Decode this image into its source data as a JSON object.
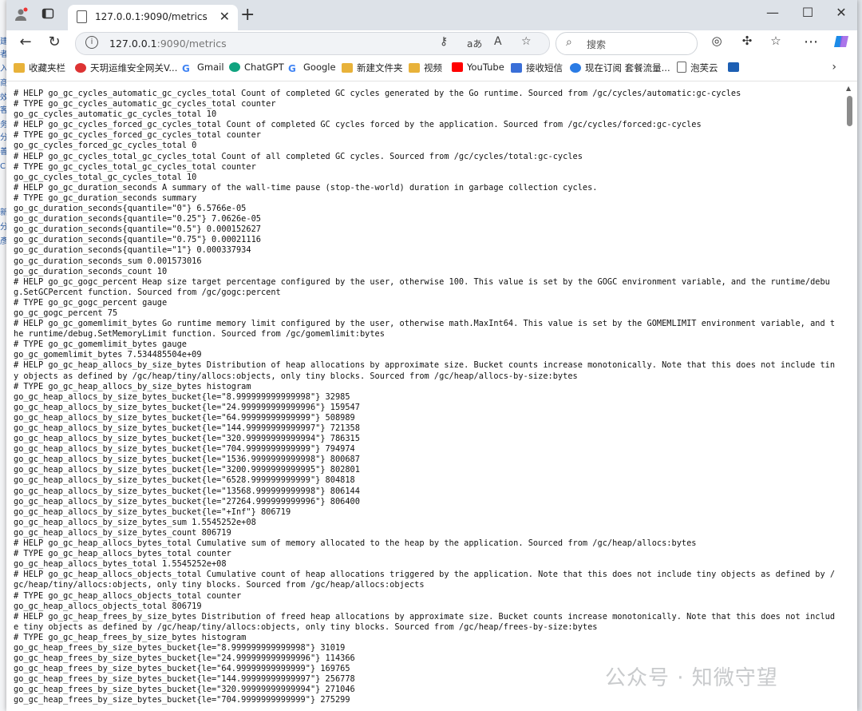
{
  "browser": {
    "tab_title": "127.0.0.1:9090/metrics",
    "url_host": "127.0.0.1",
    "url_rest": ":9090/metrics",
    "search_placeholder": "搜索",
    "aa_label": "aあ",
    "read_aloud_label": "A",
    "bookmarks": [
      {
        "label": "收藏夹栏",
        "color": "#e8b23a"
      },
      {
        "label": "天玥运维安全网关V...",
        "color": "#d33"
      },
      {
        "label": "Gmail",
        "color": "#4285f4"
      },
      {
        "label": "ChatGPT",
        "color": "#10a37f"
      },
      {
        "label": "Google",
        "color": "#4285f4"
      },
      {
        "label": "新建文件夹",
        "color": "#e8b23a"
      },
      {
        "label": "视频",
        "color": "#e8b23a"
      },
      {
        "label": "YouTube",
        "color": "#ff0000"
      },
      {
        "label": "接收短信",
        "color": "#3a6fd8"
      },
      {
        "label": "现在订阅 套餐流量...",
        "color": "#2a7be4"
      },
      {
        "label": "泡芙云",
        "color": "#888"
      },
      {
        "label": "",
        "color": "#1d5fb3"
      }
    ]
  },
  "metrics_text": "# HELP go_gc_cycles_automatic_gc_cycles_total Count of completed GC cycles generated by the Go runtime. Sourced from /gc/cycles/automatic:gc-cycles\n# TYPE go_gc_cycles_automatic_gc_cycles_total counter\ngo_gc_cycles_automatic_gc_cycles_total 10\n# HELP go_gc_cycles_forced_gc_cycles_total Count of completed GC cycles forced by the application. Sourced from /gc/cycles/forced:gc-cycles\n# TYPE go_gc_cycles_forced_gc_cycles_total counter\ngo_gc_cycles_forced_gc_cycles_total 0\n# HELP go_gc_cycles_total_gc_cycles_total Count of all completed GC cycles. Sourced from /gc/cycles/total:gc-cycles\n# TYPE go_gc_cycles_total_gc_cycles_total counter\ngo_gc_cycles_total_gc_cycles_total 10\n# HELP go_gc_duration_seconds A summary of the wall-time pause (stop-the-world) duration in garbage collection cycles.\n# TYPE go_gc_duration_seconds summary\ngo_gc_duration_seconds{quantile=\"0\"} 6.5766e-05\ngo_gc_duration_seconds{quantile=\"0.25\"} 7.0626e-05\ngo_gc_duration_seconds{quantile=\"0.5\"} 0.000152627\ngo_gc_duration_seconds{quantile=\"0.75\"} 0.00021116\ngo_gc_duration_seconds{quantile=\"1\"} 0.000337934\ngo_gc_duration_seconds_sum 0.001573016\ngo_gc_duration_seconds_count 10\n# HELP go_gc_gogc_percent Heap size target percentage configured by the user, otherwise 100. This value is set by the GOGC environment variable, and the runtime/debug.SetGCPercent function. Sourced from /gc/gogc:percent\n# TYPE go_gc_gogc_percent gauge\ngo_gc_gogc_percent 75\n# HELP go_gc_gomemlimit_bytes Go runtime memory limit configured by the user, otherwise math.MaxInt64. This value is set by the GOMEMLIMIT environment variable, and the runtime/debug.SetMemoryLimit function. Sourced from /gc/gomemlimit:bytes\n# TYPE go_gc_gomemlimit_bytes gauge\ngo_gc_gomemlimit_bytes 7.534485504e+09\n# HELP go_gc_heap_allocs_by_size_bytes Distribution of heap allocations by approximate size. Bucket counts increase monotonically. Note that this does not include tiny objects as defined by /gc/heap/tiny/allocs:objects, only tiny blocks. Sourced from /gc/heap/allocs-by-size:bytes\n# TYPE go_gc_heap_allocs_by_size_bytes histogram\ngo_gc_heap_allocs_by_size_bytes_bucket{le=\"8.999999999999998\"} 32985\ngo_gc_heap_allocs_by_size_bytes_bucket{le=\"24.999999999999996\"} 159547\ngo_gc_heap_allocs_by_size_bytes_bucket{le=\"64.99999999999999\"} 508989\ngo_gc_heap_allocs_by_size_bytes_bucket{le=\"144.99999999999997\"} 721358\ngo_gc_heap_allocs_by_size_bytes_bucket{le=\"320.99999999999994\"} 786315\ngo_gc_heap_allocs_by_size_bytes_bucket{le=\"704.9999999999999\"} 794974\ngo_gc_heap_allocs_by_size_bytes_bucket{le=\"1536.9999999999998\"} 800687\ngo_gc_heap_allocs_by_size_bytes_bucket{le=\"3200.9999999999995\"} 802801\ngo_gc_heap_allocs_by_size_bytes_bucket{le=\"6528.999999999999\"} 804818\ngo_gc_heap_allocs_by_size_bytes_bucket{le=\"13568.999999999998\"} 806144\ngo_gc_heap_allocs_by_size_bytes_bucket{le=\"27264.999999999996\"} 806400\ngo_gc_heap_allocs_by_size_bytes_bucket{le=\"+Inf\"} 806719\ngo_gc_heap_allocs_by_size_bytes_sum 1.5545252e+08\ngo_gc_heap_allocs_by_size_bytes_count 806719\n# HELP go_gc_heap_allocs_bytes_total Cumulative sum of memory allocated to the heap by the application. Sourced from /gc/heap/allocs:bytes\n# TYPE go_gc_heap_allocs_bytes_total counter\ngo_gc_heap_allocs_bytes_total 1.5545252e+08\n# HELP go_gc_heap_allocs_objects_total Cumulative count of heap allocations triggered by the application. Note that this does not include tiny objects as defined by /gc/heap/tiny/allocs:objects, only tiny blocks. Sourced from /gc/heap/allocs:objects\n# TYPE go_gc_heap_allocs_objects_total counter\ngo_gc_heap_allocs_objects_total 806719\n# HELP go_gc_heap_frees_by_size_bytes Distribution of freed heap allocations by approximate size. Bucket counts increase monotonically. Note that this does not include tiny objects as defined by /gc/heap/tiny/allocs:objects, only tiny blocks. Sourced from /gc/heap/frees-by-size:bytes\n# TYPE go_gc_heap_frees_by_size_bytes histogram\ngo_gc_heap_frees_by_size_bytes_bucket{le=\"8.999999999999998\"} 31019\ngo_gc_heap_frees_by_size_bytes_bucket{le=\"24.999999999999996\"} 114366\ngo_gc_heap_frees_by_size_bytes_bucket{le=\"64.99999999999999\"} 169765\ngo_gc_heap_frees_by_size_bytes_bucket{le=\"144.99999999999997\"} 256778\ngo_gc_heap_frees_by_size_bytes_bucket{le=\"320.99999999999994\"} 271046\ngo_gc_heap_frees_by_size_bytes_bucket{le=\"704.9999999999999\"} 275299",
  "watermark": "公众号 · 知微守望",
  "side_chars": [
    "建",
    "者",
    "入",
    "商",
    "效",
    "客",
    "务",
    "分",
    "善",
    "C",
    "新",
    "分",
    "彥"
  ]
}
